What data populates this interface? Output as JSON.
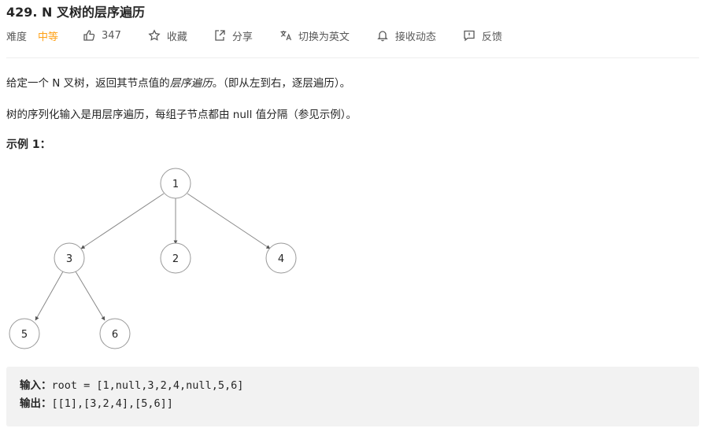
{
  "problem": {
    "title": "429. N 叉树的层序遍历"
  },
  "meta": {
    "difficulty_label": "难度",
    "difficulty_value": "中等",
    "likes": "347",
    "favorite_label": "收藏",
    "share_label": "分享",
    "language_label": "切换为英文",
    "notify_label": "接收动态",
    "feedback_label": "反馈",
    "difficulty_color": "#ffa116"
  },
  "description": {
    "p1_pre": "给定一个 N 叉树，返回其节点值的",
    "p1_em": "层序遍历",
    "p1_post": "。（即从左到右，逐层遍历）。",
    "p2": "树的序列化输入是用层序遍历，每组子节点都由 null 值分隔（参见示例）。",
    "example_title": "示例 1："
  },
  "tree": {
    "nodes": [
      "1",
      "3",
      "2",
      "4",
      "5",
      "6"
    ]
  },
  "example": {
    "input_label": "输入：",
    "input_value": "root = [1,null,3,2,4,null,5,6]",
    "output_label": "输出：",
    "output_value": "[[1],[3,2,4],[5,6]]"
  }
}
